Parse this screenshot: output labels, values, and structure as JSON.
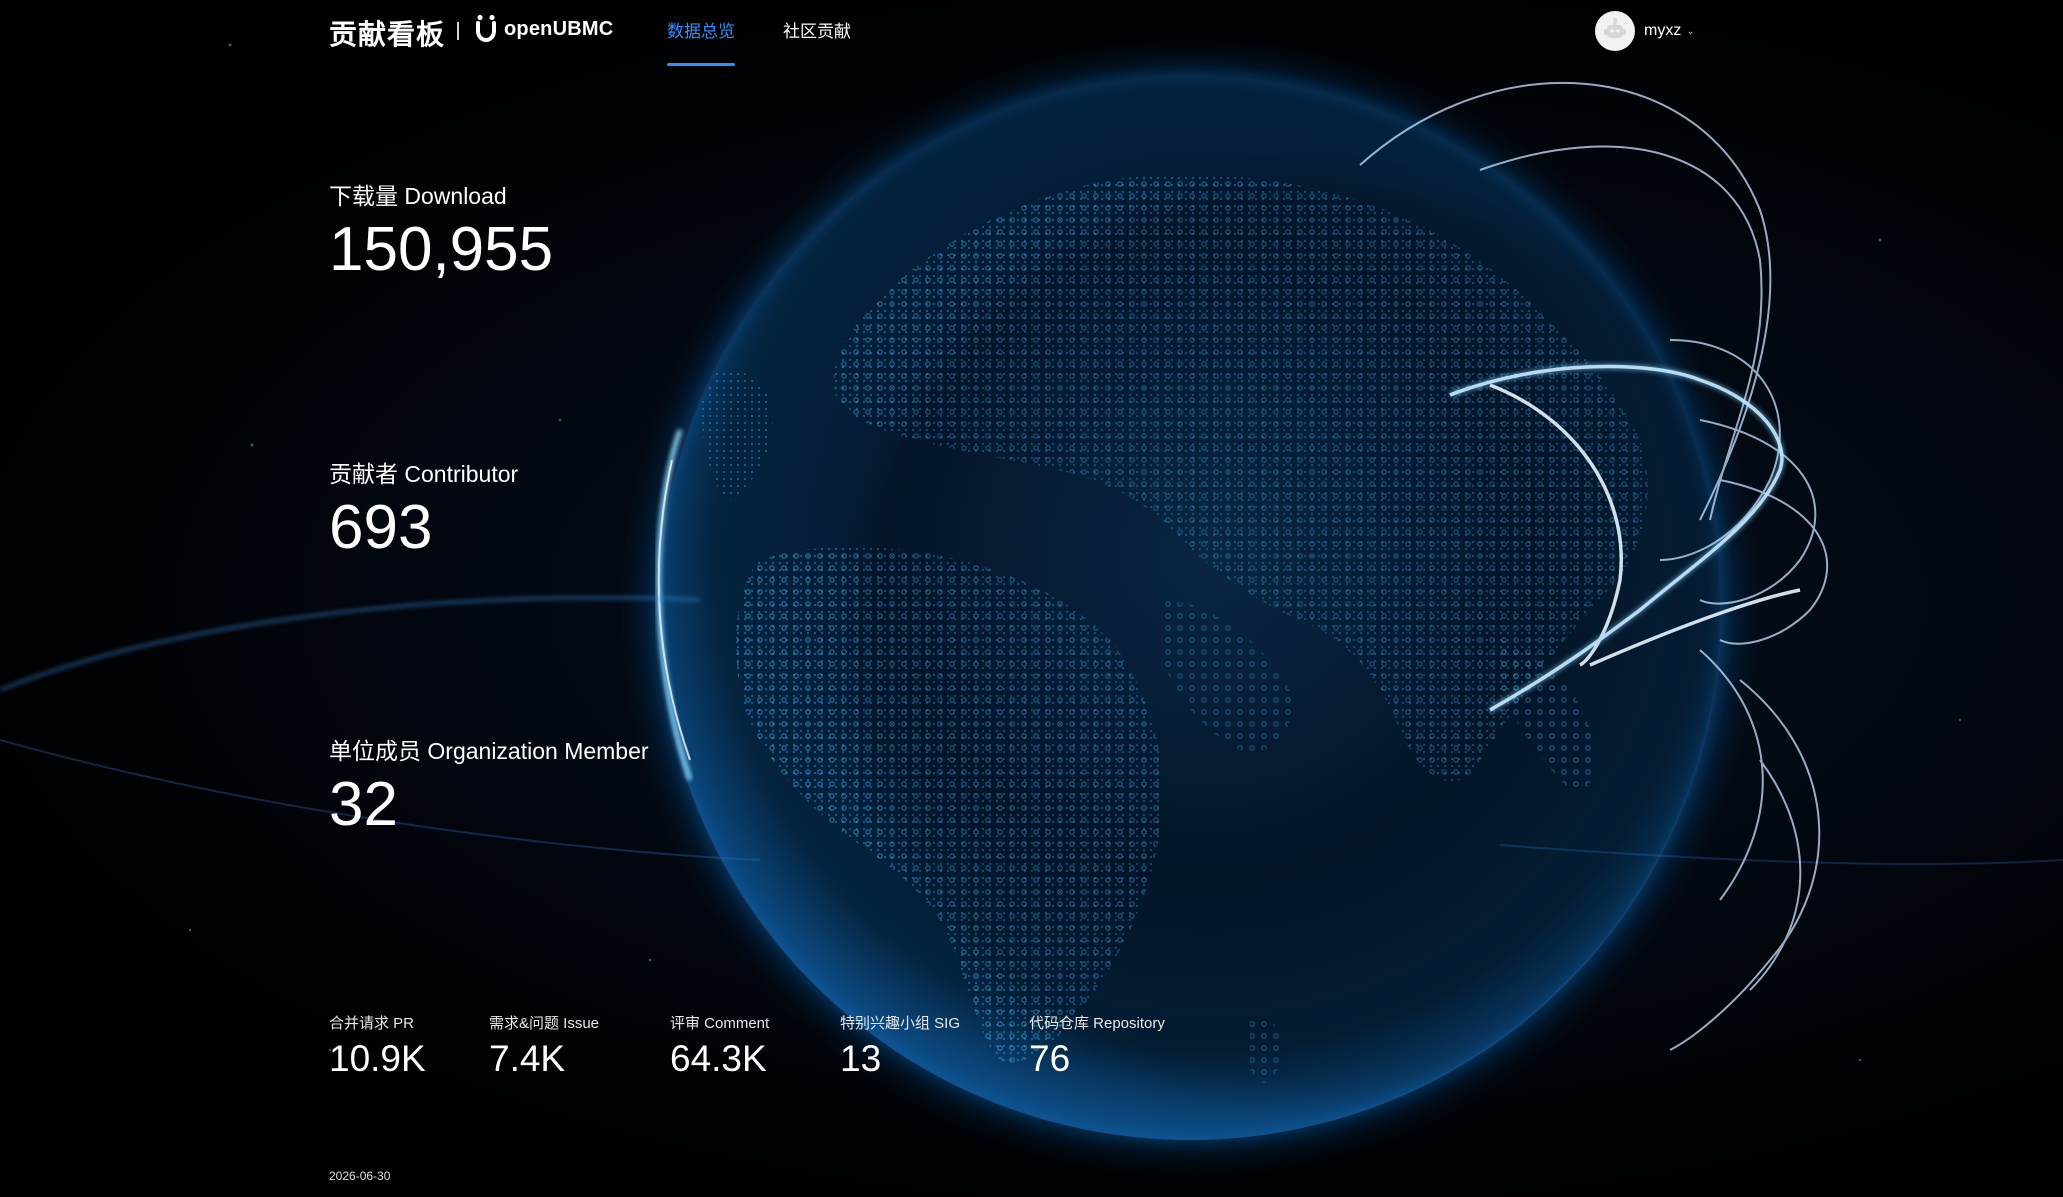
{
  "header": {
    "brand_title": "贡献看板",
    "logo_text": "openUBMC",
    "logo_icon": "openubmc-logo-icon",
    "nav": [
      {
        "label": "数据总览",
        "active": true
      },
      {
        "label": "社区贡献",
        "active": false
      }
    ],
    "user": {
      "name": "myxz",
      "avatar_icon": "robot-avatar-icon",
      "caret_icon": "chevron-down-icon",
      "caret": "⌄"
    }
  },
  "metrics": {
    "download": {
      "label": "下载量 Download",
      "value": "150,955"
    },
    "contributor": {
      "label": "贡献者 Contributor",
      "value": "693"
    },
    "org_member": {
      "label": "单位成员 Organization Member",
      "value": "32"
    }
  },
  "stats": [
    {
      "label": "合并请求 PR",
      "value": "10.9K"
    },
    {
      "label": "需求&问题 Issue",
      "value": "7.4K"
    },
    {
      "label": "评审 Comment",
      "value": "64.3K"
    },
    {
      "label": "特别兴趣小组 SIG",
      "value": "13"
    },
    {
      "label": "代码仓库 Repository",
      "value": "76"
    }
  ],
  "footer": {
    "date": "2026-06-30"
  },
  "colors": {
    "accent": "#2f8fff",
    "background": "#000000",
    "globe_glow": "#1ea7ff",
    "text": "#ffffff"
  }
}
